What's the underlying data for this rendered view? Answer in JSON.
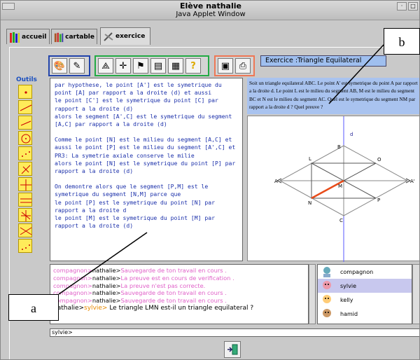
{
  "window": {
    "title": "Elève nathalie",
    "subtitle": "Java Applet Window"
  },
  "tabs": [
    {
      "label": "accueil"
    },
    {
      "label": "cartable"
    },
    {
      "label": "exercice"
    }
  ],
  "outils_label": "Outils",
  "exercise_title": "Exercice :Triangle Equilateral",
  "statement": "Soit un triangle equilateral ABC. Le point A' est symetrique du point A par rapport a la droite d. Le point L est le milieu du segment AB, M est le milieu du segment BC et N est le milieu du segment AC. Quel est le symetrique du segment NM par rapport a la droite d ? Quel preuve ?",
  "proof_paragraphs": [
    "par hypothese, le point [A'] est le symetrique du\npoint [A] par rapport a la droite (d) et aussi\nle point [C'] est le symetrique du point [C] par\nrapport a la droite (d)\nalors le segment [A',C] est le symetrique du segment\n[A,C] par rapport a la droite (d)",
    "Comme le point [N] est le milieu du segment [A,C] et\naussi le point [P] est le milieu du segment [A',C] et\nPR3: La symetrie axiale conserve le milie\nalors le point [N] est le symetrique du point [P] par\nrapport a la droite (d)",
    "On demontre alors que le segment [P,M] est le\nsymetrique du segment [N,M] parce que\nle point [P] est le symetrique du point [N] par\nrapport a la droite d\nle point [M] est le symetrique du point [M] par\nrapport a la droite (d)"
  ],
  "figure_labels": {
    "d": "d",
    "B": "B",
    "L": "L",
    "O": "O",
    "A": "A",
    "M": "M",
    "A2": "A'",
    "N": "N",
    "P": "P",
    "C": "C"
  },
  "chat": [
    {
      "prefix": "compagnon>",
      "who": "nathalie>",
      "msg": "Sauvegarde de ton travail en cours ."
    },
    {
      "prefix": "compagnon>",
      "who": "nathalie>",
      "msg": "La preuve est en cours de verification ."
    },
    {
      "prefix": "compagnon>",
      "who": "nathalie>",
      "msg": "La preuve n'est pas correcte."
    },
    {
      "prefix": "compagnon>",
      "who": "nathalie>",
      "msg": "Sauvegarde de ton travail en cours ."
    },
    {
      "prefix": "compagnon>",
      "who": "nathalie>",
      "msg": "Sauvegarde de ton travail en cours ."
    }
  ],
  "last_chat": {
    "from": "nathalie>",
    "to": "sylvie>",
    "msg": " Le triangle LMN est-il un triangle equilateral ?"
  },
  "users": [
    {
      "name": "compagnon"
    },
    {
      "name": "sylvie"
    },
    {
      "name": "kelly"
    },
    {
      "name": "hamid"
    }
  ],
  "input_value": "sylvie>",
  "callouts": {
    "a": "a",
    "b": "b"
  },
  "colors": {
    "statement_bg": "#a9c3ef",
    "chat_system": "#e060c8",
    "chat_to": "#e88a00",
    "proof_text": "#1a2faa"
  }
}
